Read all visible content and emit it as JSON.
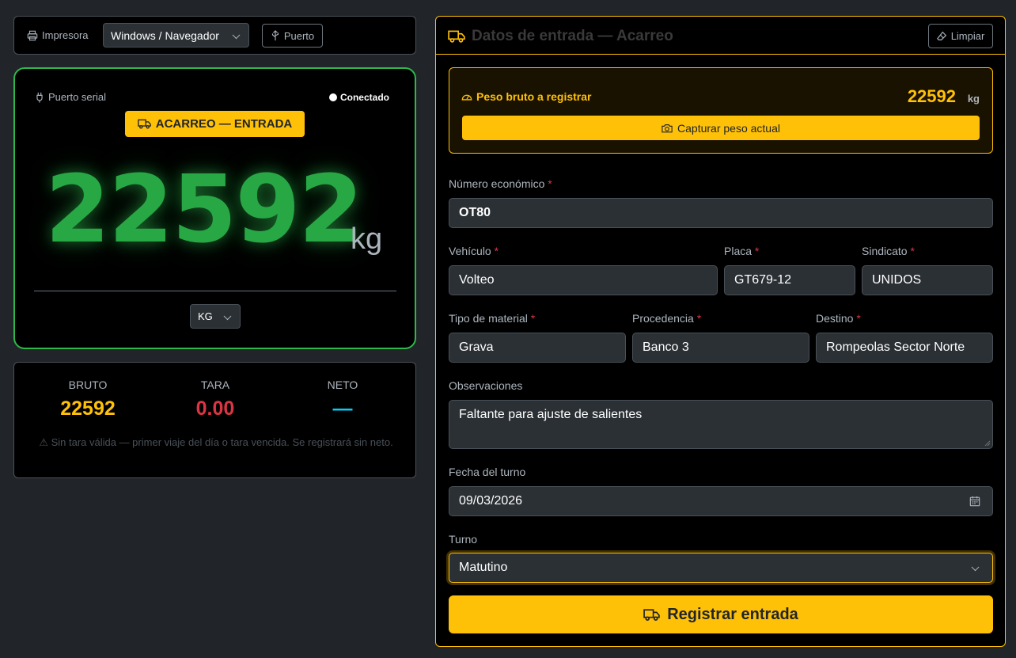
{
  "printer_bar": {
    "printer_label": "Impresora",
    "printer_select_value": "Windows / Navegador",
    "port_button": "Puerto"
  },
  "scale": {
    "serial_label": "Puerto serial",
    "connection_status": "Conectado",
    "mode_badge": "ACARREO — ENTRADA",
    "weight": "22592",
    "unit": "kg",
    "unit_select_value": "KG",
    "weight_color": "#28a745"
  },
  "totals": {
    "bruto_label": "BRUTO",
    "bruto_value": "22592",
    "tara_label": "TARA",
    "tara_value": "0.00",
    "neto_label": "NETO",
    "neto_value": "—",
    "warning": "⚠ Sin tara válida — primer viaje del día o tara vencida. Se registrará sin neto.",
    "colors": {
      "bruto": "#ffc107",
      "tara": "#dc3545",
      "neto": "#0dcaf0"
    }
  },
  "form": {
    "title": "Datos de entrada — Acarreo",
    "clear_button": "Limpiar",
    "peso_label": "Peso bruto a registrar",
    "peso_value": "22592",
    "peso_unit": "kg",
    "capture_button": "Capturar peso actual",
    "numero_economico": {
      "label": "Número económico",
      "value": "OT80"
    },
    "vehiculo": {
      "label": "Vehículo",
      "value": "Volteo"
    },
    "placa": {
      "label": "Placa",
      "value": "GT679-12"
    },
    "sindicato": {
      "label": "Sindicato",
      "value": "UNIDOS"
    },
    "tipo_material": {
      "label": "Tipo de material",
      "value": "Grava"
    },
    "procedencia": {
      "label": "Procedencia",
      "value": "Banco 3"
    },
    "destino": {
      "label": "Destino",
      "value": "Rompeolas Sector Norte"
    },
    "observaciones": {
      "label": "Observaciones",
      "value": "Faltante para ajuste de salientes"
    },
    "fecha_turno": {
      "label": "Fecha del turno",
      "value": "09/03/2026"
    },
    "turno": {
      "label": "Turno",
      "value": "Matutino"
    },
    "required_mark": "*",
    "submit_button": "Registrar entrada",
    "accent_color": "#ffc107"
  }
}
